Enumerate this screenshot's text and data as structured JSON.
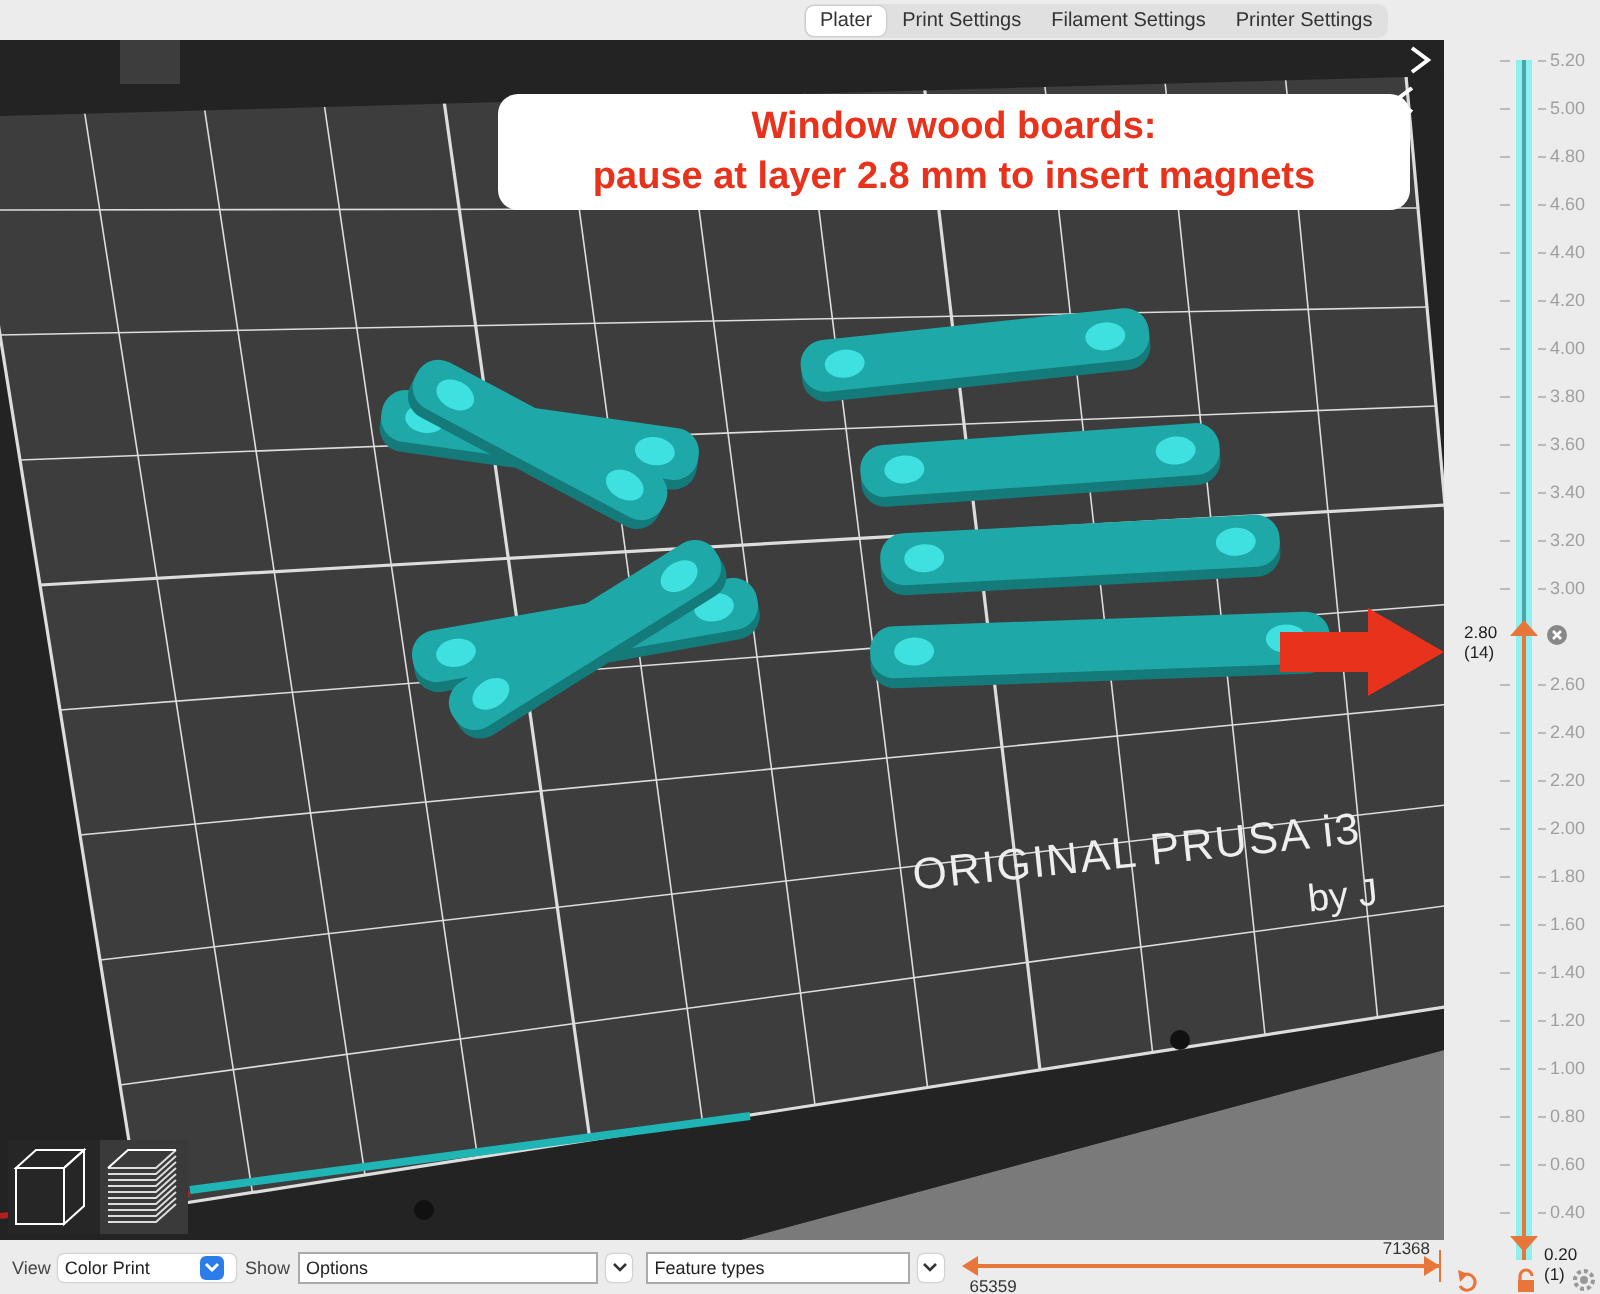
{
  "tabs": [
    {
      "label": "Plater",
      "selected": true
    },
    {
      "label": "Print Settings",
      "selected": false
    },
    {
      "label": "Filament Settings",
      "selected": false
    },
    {
      "label": "Printer Settings",
      "selected": false
    }
  ],
  "annotation": {
    "lines": [
      "Window wood boards:",
      "pause at layer 2.8 mm to insert magnets"
    ]
  },
  "bed_text": {
    "brand": "ORIGINAL PRUSA i3",
    "byline": "by J"
  },
  "layer_slider": {
    "ticks": [
      "5.20",
      "5.00",
      "4.80",
      "4.60",
      "4.40",
      "4.20",
      "4.00",
      "3.80",
      "3.60",
      "3.40",
      "3.20",
      "3.00",
      "2.60",
      "2.40",
      "2.20",
      "2.00",
      "1.80",
      "1.60",
      "1.40",
      "1.20",
      "1.00",
      "0.80",
      "0.60",
      "0.40"
    ],
    "upper": {
      "value": "2.80",
      "layer": "(14)",
      "level": 0.52
    },
    "lower": {
      "value": "0.20",
      "layer": "(1)",
      "level": 0
    }
  },
  "move_slider": {
    "start": {
      "value": "65359",
      "level": 0
    },
    "end": {
      "value": "71368",
      "level": 1
    }
  },
  "bottom_bar": {
    "view_label": "View",
    "view_value": "Color Print",
    "show_label": "Show",
    "show_value": "Options",
    "feature_value": "Feature types"
  }
}
